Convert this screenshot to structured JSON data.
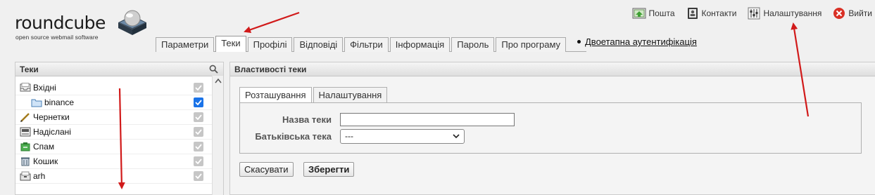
{
  "logo": {
    "word": "roundcube",
    "tagline": "open source webmail software"
  },
  "topnav": [
    {
      "label": "Пошта",
      "icon": "mail-icon"
    },
    {
      "label": "Контакти",
      "icon": "contacts-icon"
    },
    {
      "label": "Налаштування",
      "icon": "settings-icon"
    },
    {
      "label": "Вийти",
      "icon": "logout-icon"
    }
  ],
  "tabs": [
    "Параметри",
    "Теки",
    "Профілі",
    "Відповіді",
    "Фільтри",
    "Інформація",
    "Пароль",
    "Про програму"
  ],
  "active_tab": "Теки",
  "twofa_link": "Двоетапна аутентифікація",
  "folders": {
    "title": "Теки",
    "items": [
      {
        "label": "Вхідні",
        "icon": "inbox-icon",
        "checked": true,
        "enabled": false
      },
      {
        "label": "binance",
        "icon": "folder-icon",
        "checked": true,
        "enabled": true
      },
      {
        "label": "Чернетки",
        "icon": "drafts-icon",
        "checked": true,
        "enabled": false
      },
      {
        "label": "Надіслані",
        "icon": "sent-icon",
        "checked": true,
        "enabled": false
      },
      {
        "label": "Спам",
        "icon": "spam-icon",
        "checked": true,
        "enabled": false
      },
      {
        "label": "Кошик",
        "icon": "trash-icon",
        "checked": true,
        "enabled": false
      },
      {
        "label": "arh",
        "icon": "archive-icon",
        "checked": true,
        "enabled": false
      }
    ]
  },
  "properties": {
    "title": "Властивості теки",
    "tabs": [
      "Розташування",
      "Налаштування"
    ],
    "folder_name_label": "Назва теки",
    "folder_name_value": "",
    "parent_label": "Батьківська тека",
    "parent_value": "---",
    "cancel_label": "Скасувати",
    "save_label": "Зберегти"
  },
  "colors": {
    "annotation": "#d11a1a",
    "checkbox_active": "#1a73e8",
    "checkbox_disabled": "#c6c6c6"
  }
}
